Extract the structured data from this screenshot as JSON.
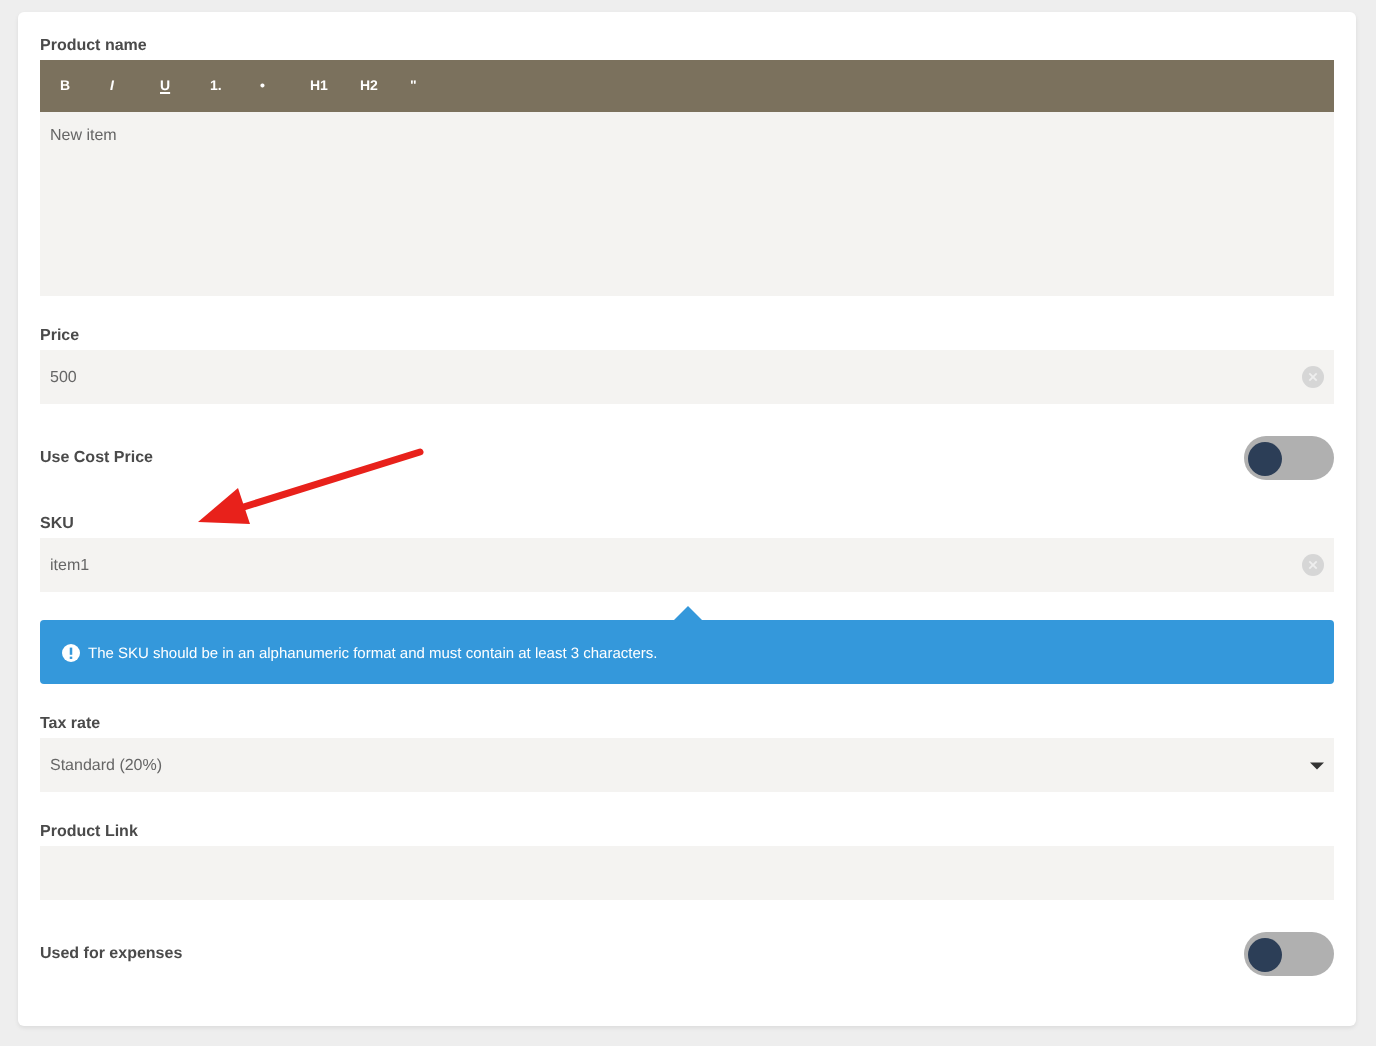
{
  "fields": [
    {
      "kind": "editor",
      "label": "Product name",
      "toolbar": [
        "B",
        "I",
        "U",
        "1.",
        "•",
        "H1",
        "H2",
        "\""
      ],
      "value": "New item"
    },
    {
      "kind": "text",
      "label": "Price",
      "value": "500",
      "clearable": true
    },
    {
      "kind": "toggle",
      "label": "Use Cost Price",
      "on": false
    },
    {
      "kind": "text",
      "label": "SKU",
      "value": "item1",
      "clearable": true,
      "hint": "The SKU should be in an alphanumeric format and must contain at least 3 characters."
    },
    {
      "kind": "select",
      "label": "Tax rate",
      "value": "Standard (20%)"
    },
    {
      "kind": "text",
      "label": "Product Link"
    },
    {
      "kind": "toggle",
      "label": "Used for expenses",
      "on": false
    }
  ]
}
